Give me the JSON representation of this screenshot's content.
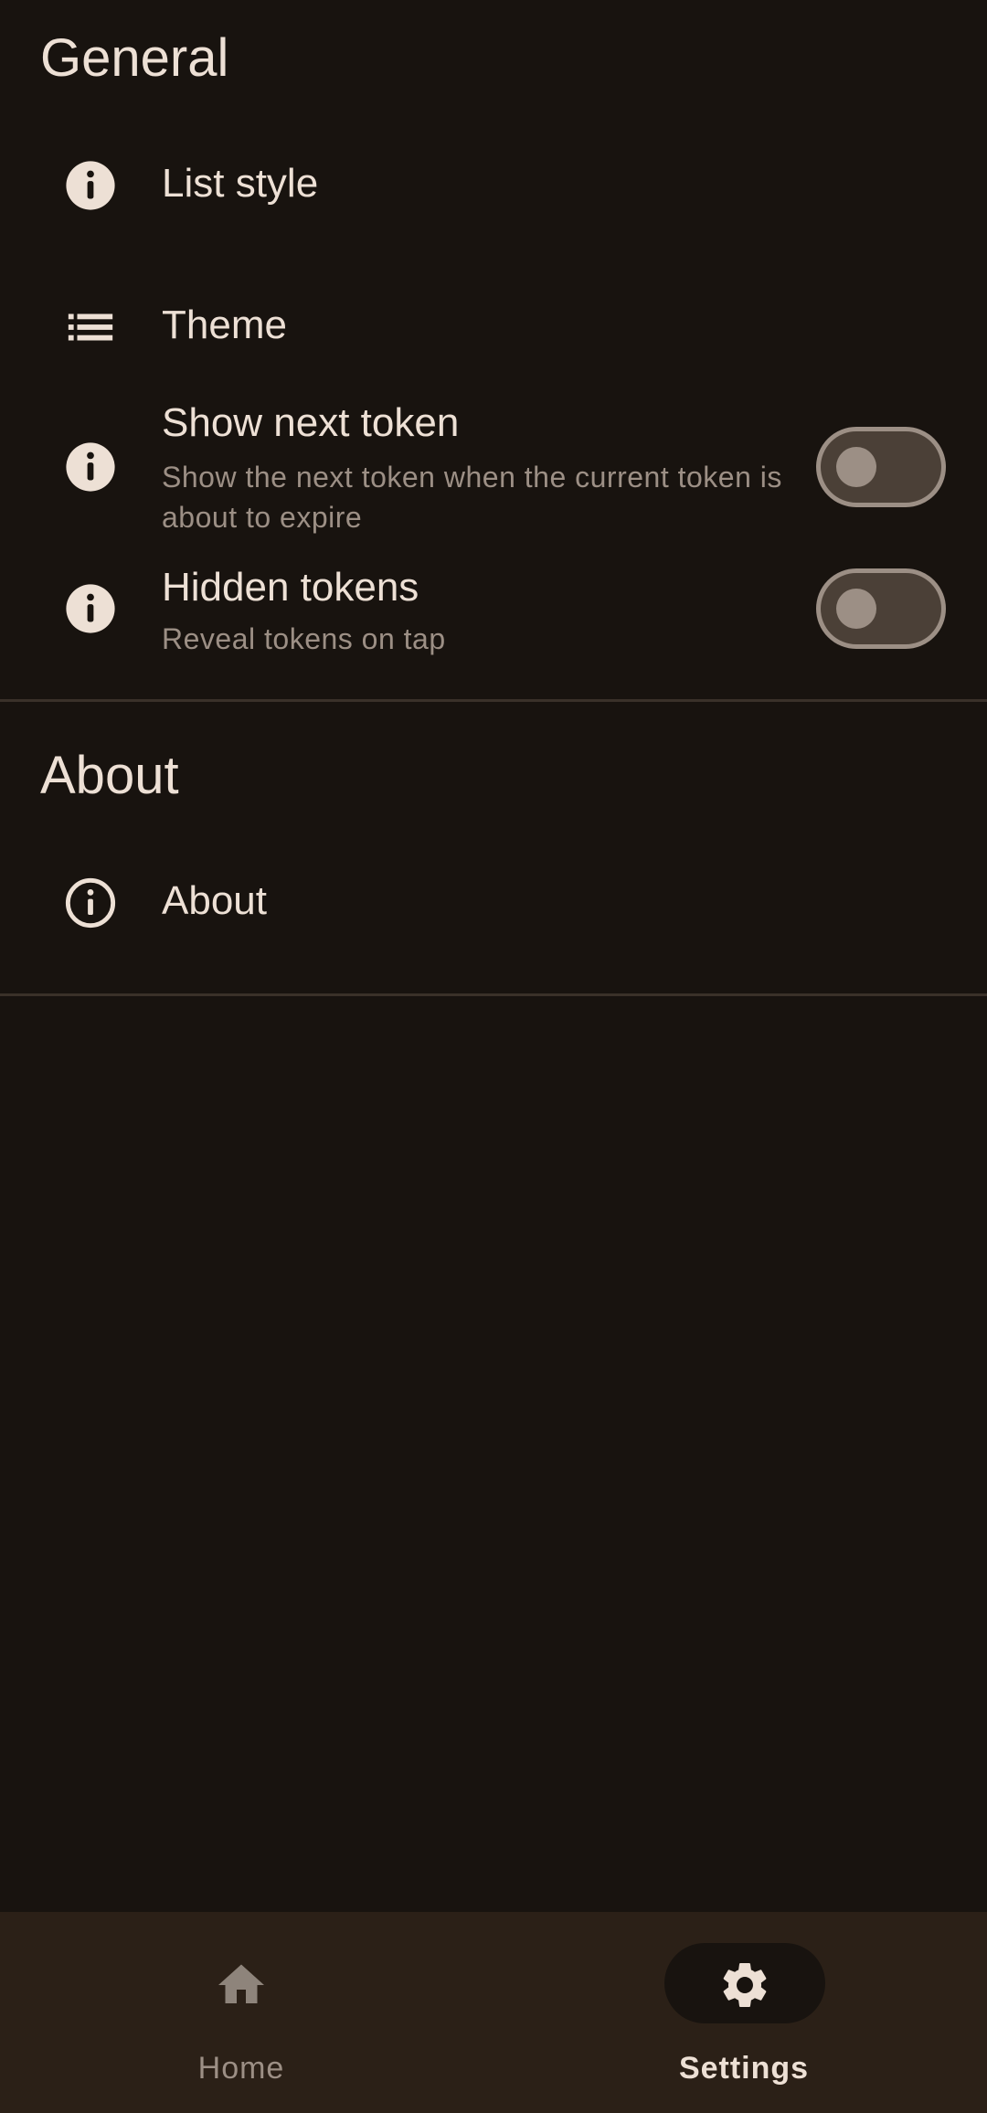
{
  "general": {
    "title": "General",
    "items": [
      {
        "label": "List style",
        "icon": "info-filled-icon"
      },
      {
        "label": "Theme",
        "icon": "list-icon"
      },
      {
        "label": "Show next token",
        "subtitle": "Show the next token when the current token is about to expire",
        "icon": "info-filled-icon",
        "toggle": false
      },
      {
        "label": "Hidden tokens",
        "subtitle": "Reveal tokens on tap",
        "icon": "info-filled-icon",
        "toggle": false
      }
    ]
  },
  "about": {
    "title": "About",
    "items": [
      {
        "label": "About",
        "icon": "info-outline-icon"
      }
    ]
  },
  "bottom_nav": {
    "items": [
      {
        "label": "Home",
        "icon": "home-icon",
        "active": false
      },
      {
        "label": "Settings",
        "icon": "gear-icon",
        "active": true
      }
    ]
  },
  "colors": {
    "background": "#18130f",
    "nav_background": "#2b2017",
    "text_primary": "#ede0d5",
    "text_secondary": "#9c8f85",
    "toggle_track": "#4b4037"
  }
}
